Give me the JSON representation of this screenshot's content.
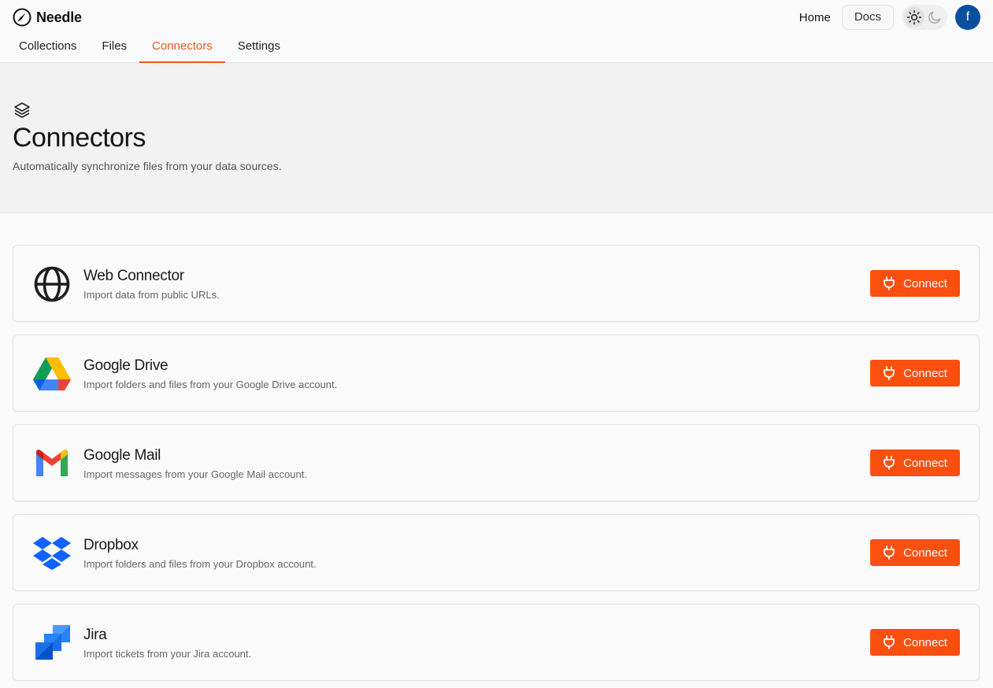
{
  "app": {
    "name": "Needle"
  },
  "nav": {
    "tabs": [
      {
        "label": "Collections"
      },
      {
        "label": "Files"
      },
      {
        "label": "Connectors",
        "active": true
      },
      {
        "label": "Settings"
      }
    ],
    "home_label": "Home",
    "docs_label": "Docs",
    "theme": {
      "selected": "light",
      "options": [
        "sun-icon",
        "moon-icon"
      ]
    },
    "avatar_initial": "f"
  },
  "header": {
    "icon": "layers-icon",
    "title": "Connectors",
    "subtitle": "Automatically synchronize files from your data sources."
  },
  "connectors": [
    {
      "icon": "globe-icon",
      "title": "Web Connector",
      "description": "Import data from public URLs.",
      "button": "Connect"
    },
    {
      "icon": "google-drive-icon",
      "title": "Google Drive",
      "description": "Import folders and files from your Google Drive account.",
      "button": "Connect"
    },
    {
      "icon": "gmail-icon",
      "title": "Google Mail",
      "description": "Import messages from your Google Mail account.",
      "button": "Connect"
    },
    {
      "icon": "dropbox-icon",
      "title": "Dropbox",
      "description": "Import folders and files from your Dropbox account.",
      "button": "Connect"
    },
    {
      "icon": "jira-icon",
      "title": "Jira",
      "description": "Import tickets from your Jira account.",
      "button": "Connect"
    }
  ],
  "colors": {
    "accent": "#fa4f0f",
    "avatar_bg": "#0a4f9e"
  }
}
